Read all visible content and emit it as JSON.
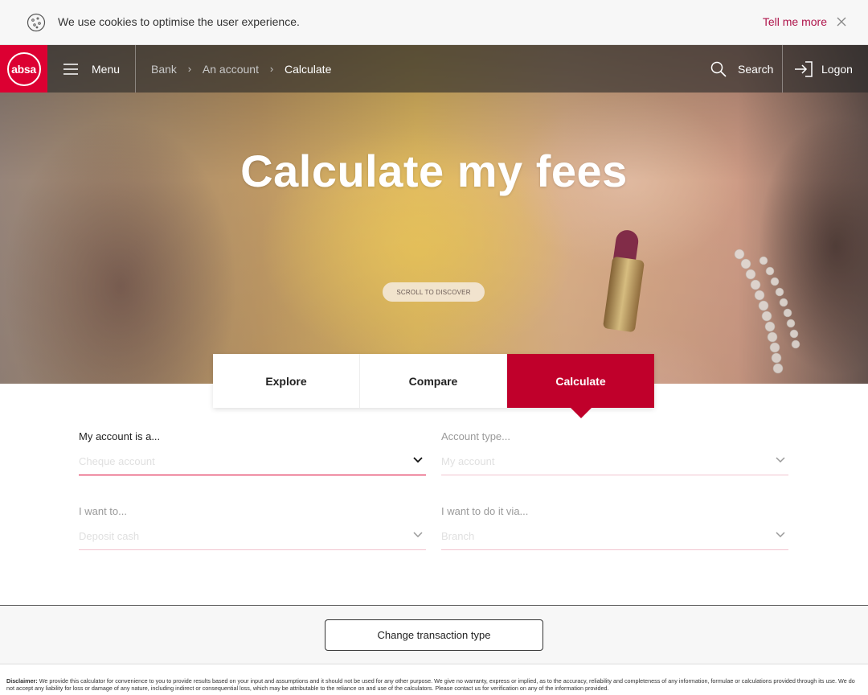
{
  "cookie_bar": {
    "message": "We use cookies to optimise the user experience.",
    "link": "Tell me more",
    "icon": "cookie-icon",
    "close_icon": "close-icon"
  },
  "nav": {
    "logo_text": "absa",
    "menu_label": "Menu",
    "breadcrumb": [
      "Bank",
      "An account",
      "Calculate"
    ],
    "search_label": "Search",
    "logon_label": "Logon",
    "brand_color": "#dc0032"
  },
  "hero": {
    "title": "Calculate my fees",
    "scroll_label": "SCROLL TO DISCOVER"
  },
  "tabs": [
    {
      "label": "Explore",
      "active": false
    },
    {
      "label": "Compare",
      "active": false
    },
    {
      "label": "Calculate",
      "active": true
    }
  ],
  "form": {
    "account_is": {
      "label": "My account is a...",
      "value": "Cheque account"
    },
    "account_type": {
      "label": "Account type...",
      "value": "My account"
    },
    "want_to": {
      "label": "I want to...",
      "value": "Deposit cash"
    },
    "do_it_via": {
      "label": "I want to do it via...",
      "value": "Branch"
    }
  },
  "actions": {
    "change_transaction": "Change transaction type"
  },
  "disclaimer": {
    "label": "Disclaimer:",
    "text": "We provide this calculator for convenience to you to provide results based on your input and assumptions and it should not be used for any other purpose. We give no warranty, express or implied, as to the accuracy, reliability and completeness of any information, formulae or calculations provided through its use. We do not accept any liability for loss or damage of any nature, including indirect or consequential loss, which may be attributable to the reliance on and use of the calculators. Please contact us for verification on any of the information provided."
  }
}
